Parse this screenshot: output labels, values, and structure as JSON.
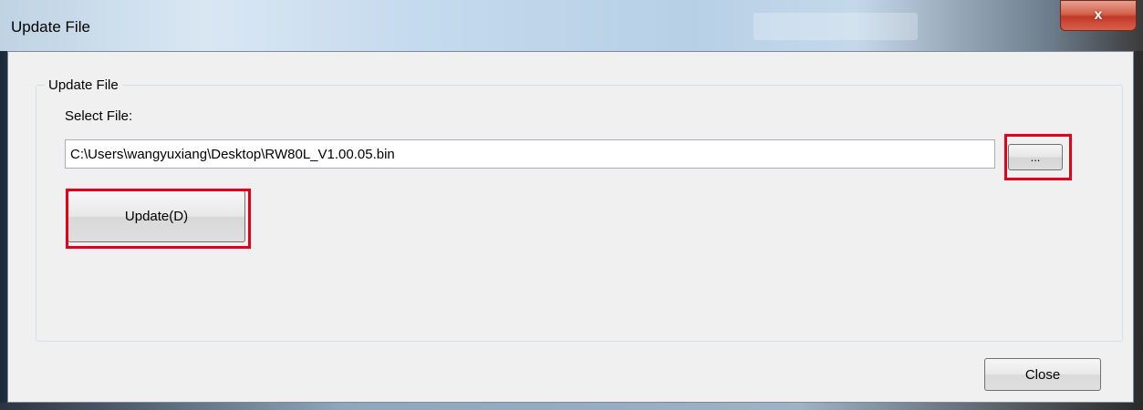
{
  "window": {
    "title": "Update File",
    "close_glyph": "x"
  },
  "group": {
    "label": "Update File"
  },
  "file_select": {
    "label": "Select File:",
    "path_value": "C:\\Users\\wangyuxiang\\Desktop\\RW80L_V1.00.05.bin",
    "browse_label": "..."
  },
  "buttons": {
    "update_label": "Update(D)",
    "close_label": "Close"
  },
  "colors": {
    "highlight": "#e3001b",
    "dialog_bg": "#f0f0f0"
  },
  "icons": {
    "close": "close-icon"
  }
}
